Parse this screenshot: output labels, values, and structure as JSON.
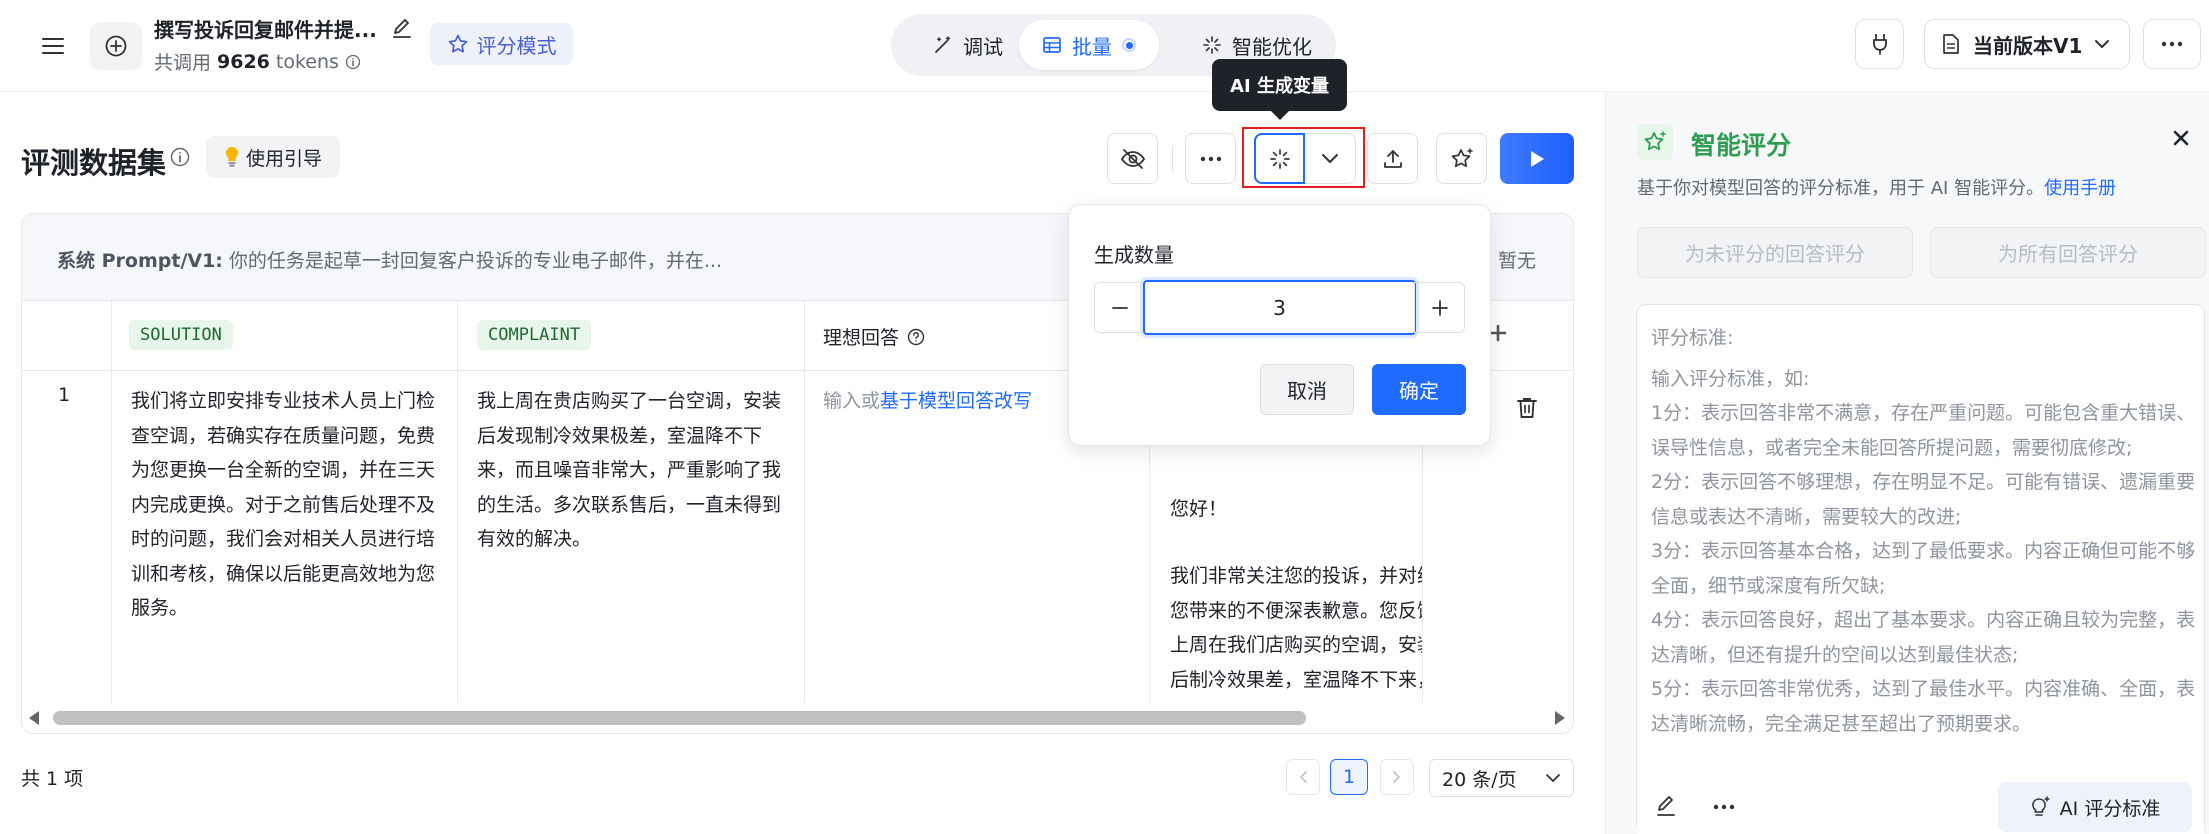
{
  "header": {
    "title": "撰写投诉回复邮件并提...",
    "tokens_prefix": "共调用",
    "tokens_value": "9626",
    "tokens_suffix": "tokens",
    "mode_badge": "评分模式",
    "tabs": [
      {
        "label": "调试"
      },
      {
        "label": "批量"
      },
      {
        "label": "智能优化"
      }
    ],
    "version_label": "当前版本V1"
  },
  "dataset": {
    "title": "评测数据集",
    "guide_label": "使用引导",
    "tooltip": "AI 生成变量",
    "system_prompt_label": "系统 Prompt/V1:",
    "system_prompt_text": "你的任务是起草一封回复客户投诉的专业电子邮件，并在...",
    "system_prompt_side": "暂无",
    "columns": [
      "SOLUTION",
      "COMPLAINT",
      "理想回答"
    ],
    "rows": [
      {
        "index": "1",
        "solution": "我们将立即安排专业技术人员上门检查空调，若确实存在质量问题，免费为您更换一台全新的空调，并在三天内完成更换。对于之前售后处理不及时的问题，我们会对相关人员进行培训和考核，确保以后能更高效地为您服务。",
        "complaint": "我上周在贵店购买了一台空调，安装后发现制冷效果极差，室温降不下来，而且噪音非常大，严重影响了我的生活。多次联系售后，一直未得到有效的解决。",
        "ideal_prefix": "输入或",
        "ideal_link": "基于模型回答改写",
        "response_greeting": "您好！",
        "response_body": "我们非常关注您的投诉，并对给您带来的不便深表歉意。您反馈上周在我们店购买的空调，安装后制冷效果差，室温降不下来，而且噪音非常大，严重"
      }
    ],
    "footer_count": "共 1 项",
    "page_current": "1",
    "page_size": "20 条/页"
  },
  "popover": {
    "label": "生成数量",
    "value": "3",
    "cancel_label": "取消",
    "confirm_label": "确定"
  },
  "scoring": {
    "title": "智能评分",
    "description": "基于你对模型回答的评分标准，用于 AI 智能评分。",
    "manual_link": "使用手册",
    "score_unscored_label": "为未评分的回答评分",
    "score_all_label": "为所有回答评分",
    "criteria_title": "评分标准:",
    "criteria_intro": "输入评分标准，如:",
    "criteria_lines": [
      "1分：表示回答非常不满意，存在严重问题。可能包含重大错误、误导性信息，或者完全未能回答所提问题，需要彻底修改;",
      "2分：表示回答不够理想，存在明显不足。可能有错误、遗漏重要信息或表达不清晰，需要较大的改进;",
      "3分：表示回答基本合格，达到了最低要求。内容正确但可能不够全面，细节或深度有所欠缺;",
      "4分：表示回答良好，超出了基本要求。内容正确且较为完整，表达清晰，但还有提升的空间以达到最佳状态;",
      "5分：表示回答非常优秀，达到了最佳水平。内容准确、全面，表达清晰流畅，完全满足甚至超出了预期要求。"
    ],
    "ai_criteria_label": "AI 评分标准"
  },
  "colors": {
    "accent": "#1f6bff",
    "highlight_box": "#e02020",
    "tag_bg": "#e8f5ea",
    "tag_text": "#1a6b2f"
  }
}
